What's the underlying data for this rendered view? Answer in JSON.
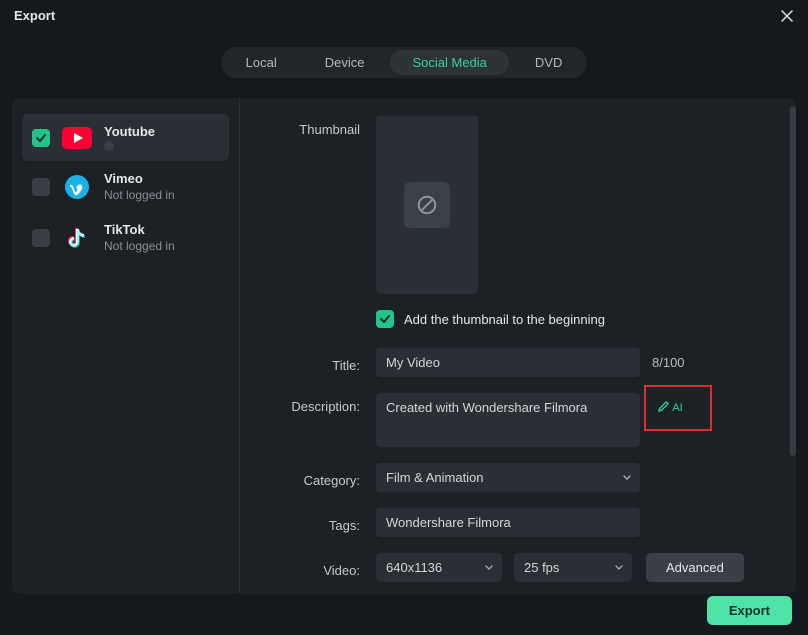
{
  "window": {
    "title": "Export"
  },
  "tabs": {
    "local": "Local",
    "device": "Device",
    "social": "Social Media",
    "dvd": "DVD"
  },
  "platforms": {
    "youtube": {
      "name": "Youtube"
    },
    "vimeo": {
      "name": "Vimeo",
      "sub": "Not logged in"
    },
    "tiktok": {
      "name": "TikTok",
      "sub": "Not logged in"
    }
  },
  "thumb": {
    "label": "Thumbnail",
    "checkbox_label": "Add the thumbnail to the beginning"
  },
  "title": {
    "label": "Title:",
    "value": "My Video",
    "counter": "8/100"
  },
  "desc": {
    "label": "Description:",
    "value": "Created with Wondershare Filmora",
    "ai": "AI"
  },
  "category": {
    "label": "Category:",
    "value": "Film & Animation"
  },
  "tags": {
    "label": "Tags:",
    "value": "Wondershare Filmora"
  },
  "video": {
    "label": "Video:",
    "resolution": "640x1136",
    "fps": "25 fps",
    "advanced": "Advanced"
  },
  "export_label": "Export"
}
